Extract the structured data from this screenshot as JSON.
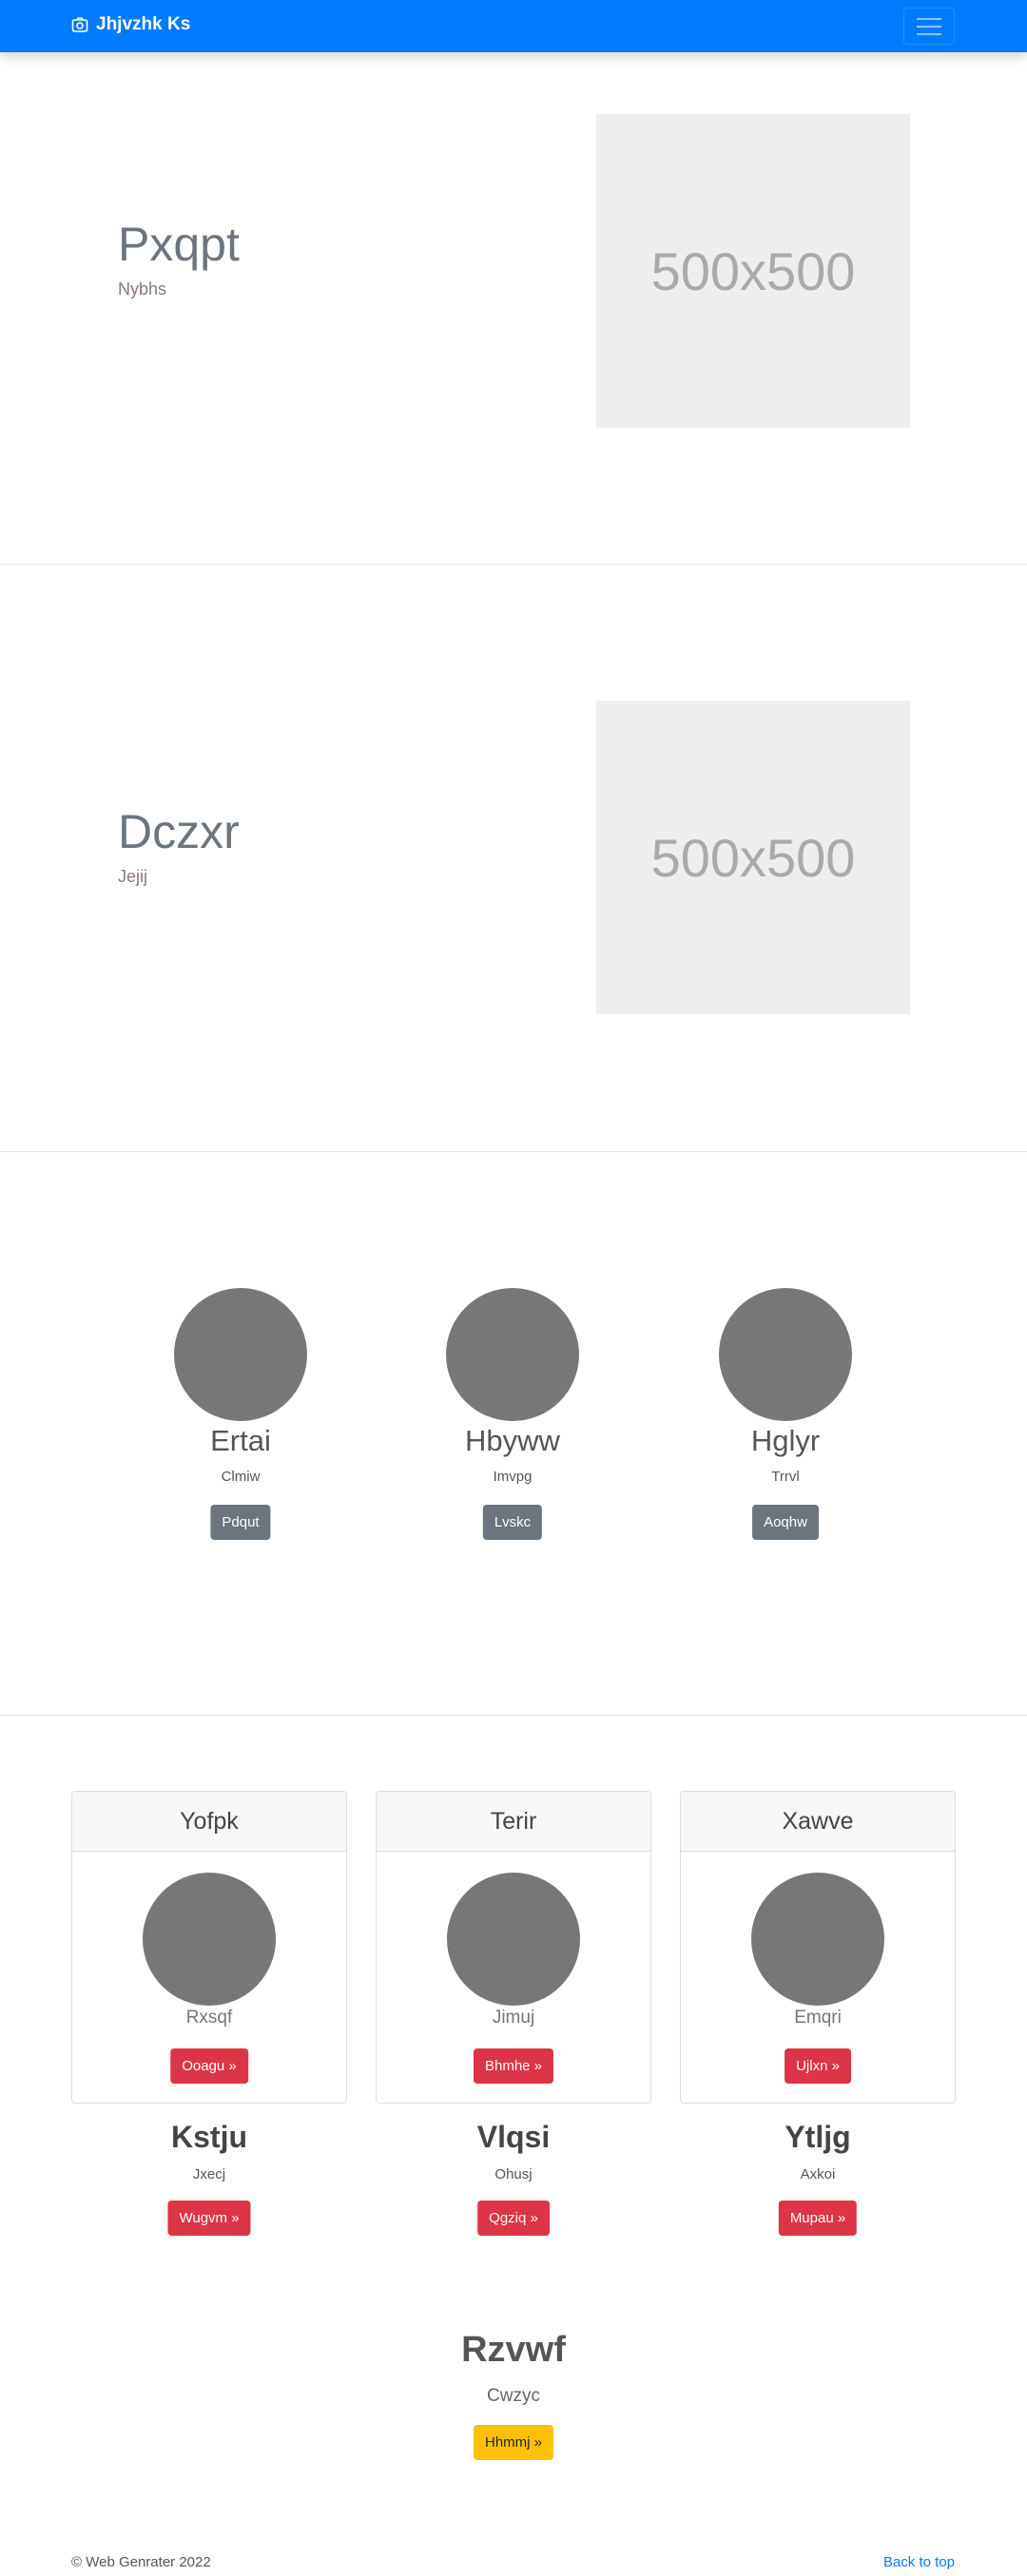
{
  "navbar": {
    "brand": "Jhjvzhk Ks",
    "brand_icon": "camera-icon",
    "toggler_icon": "hamburger-icon",
    "color": "#007bff"
  },
  "heroes": [
    {
      "title": "Pxqpt",
      "subtitle": "Nybhs",
      "image_label": "500x500"
    },
    {
      "title": "Dczxr",
      "subtitle": "Jejij",
      "image_label": "500x500"
    }
  ],
  "team": [
    {
      "name": "Ertai",
      "sub": "Clmiw",
      "button": "Pdqut"
    },
    {
      "name": "Hbyww",
      "sub": "Imvpg",
      "button": "Lvskc"
    },
    {
      "name": "Hglyr",
      "sub": "Trrvl",
      "button": "Aoqhw"
    }
  ],
  "cards": [
    {
      "header": "Yofpk",
      "sub": "Rxsqf",
      "button": "Ooagu »"
    },
    {
      "header": "Terir",
      "sub": "Jimuj",
      "button": "Bhmhe »"
    },
    {
      "header": "Xawve",
      "sub": "Emqri",
      "button": "Ujlxn »"
    }
  ],
  "features": [
    {
      "title": "Kstju",
      "sub": "Jxecj",
      "button": "Wugvm »"
    },
    {
      "title": "Vlqsi",
      "sub": "Ohusj",
      "button": "Qgziq »"
    },
    {
      "title": "Ytljg",
      "sub": "Axkoi",
      "button": "Mupau »"
    }
  ],
  "cta": {
    "title": "Rzvwf",
    "sub": "Cwzyc",
    "button": "Hhmmj »"
  },
  "footer": {
    "copyright": "© Web Genrater 2022",
    "back_to_top": "Back to top"
  }
}
